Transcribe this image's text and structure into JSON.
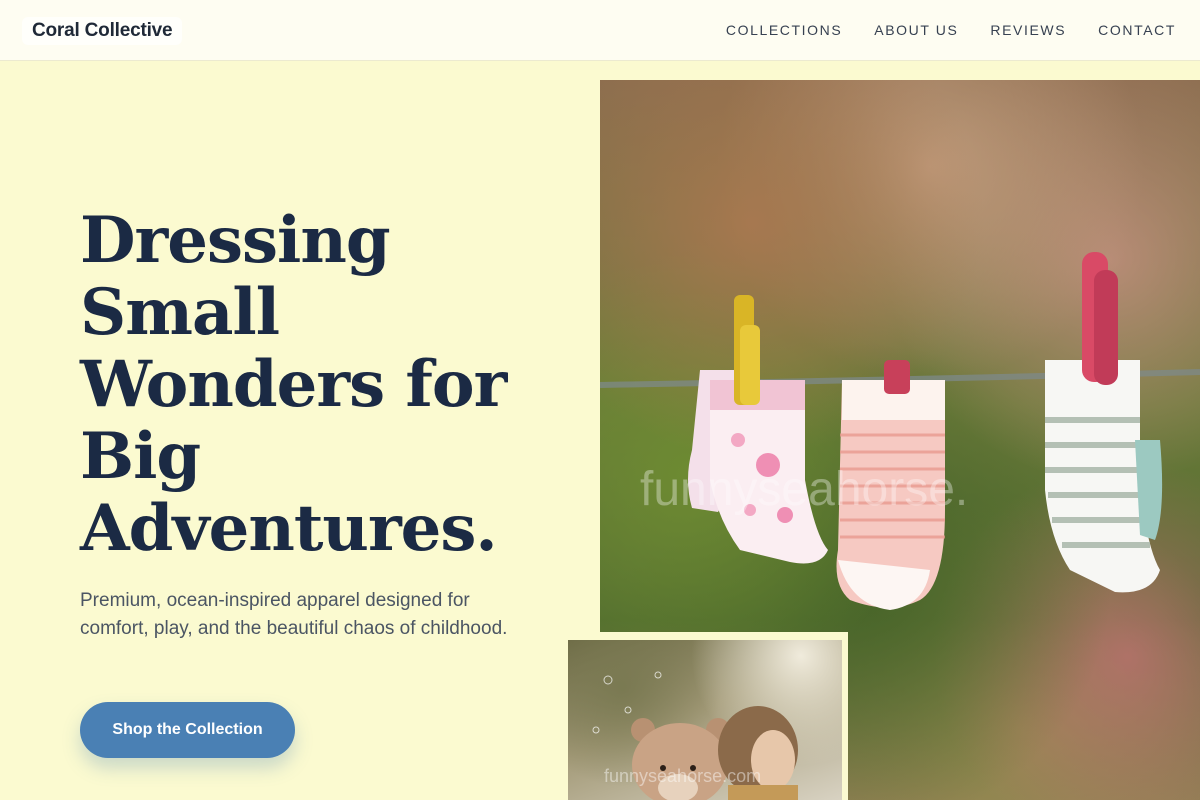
{
  "brand": {
    "name": "Coral Collective"
  },
  "nav": {
    "items": [
      {
        "label": "COLLECTIONS"
      },
      {
        "label": "ABOUT US"
      },
      {
        "label": "REVIEWS"
      },
      {
        "label": "CONTACT"
      }
    ]
  },
  "hero": {
    "title": "Dressing Small Wonders for Big Adventures.",
    "subtitle": "Premium, ocean-inspired apparel designed for comfort, play, and the beautiful chaos of childhood.",
    "cta_label": "Shop the Collection"
  },
  "images": {
    "main_watermark": "funnyseahorse.",
    "inset_watermark": "funnyseahorse.com"
  },
  "colors": {
    "background": "#fbfad0",
    "heading": "#1b2a44",
    "accent": "#4a80b4"
  }
}
